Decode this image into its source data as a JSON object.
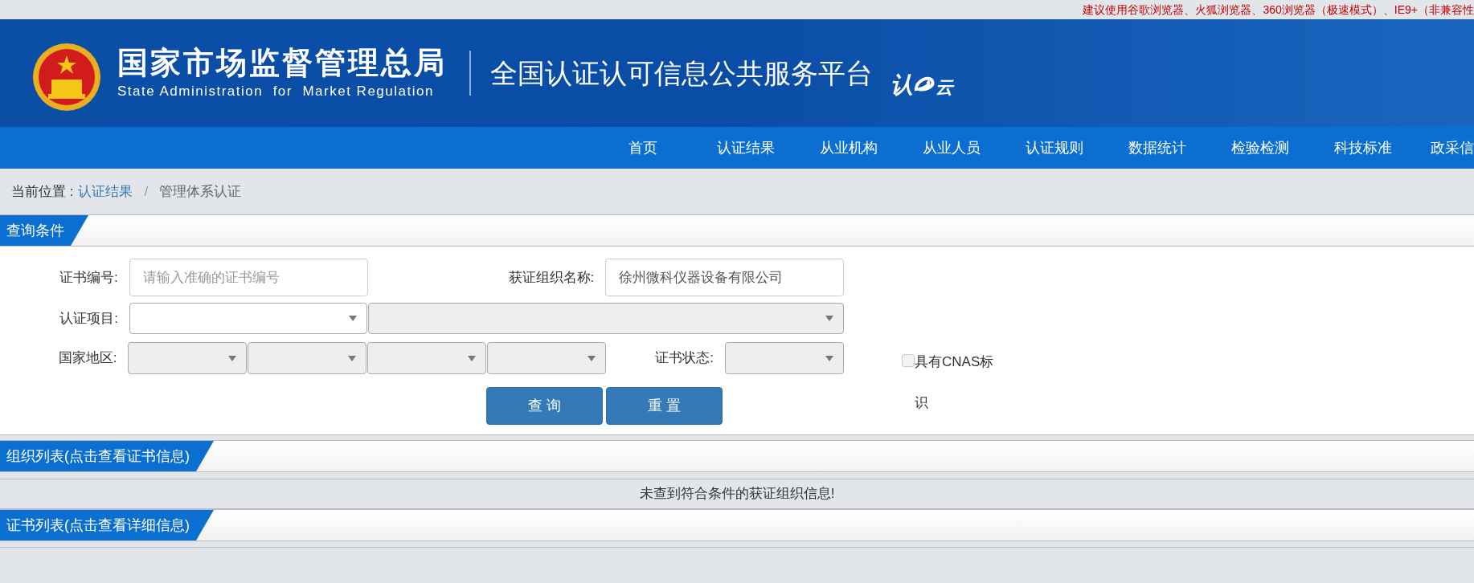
{
  "notice": "建议使用谷歌浏览器、火狐浏览器、360浏览器（极速模式）、IE9+（非兼容性",
  "header": {
    "org_name": "国家市场监督管理总局",
    "org_name_en": "State Administration  for  Market Regulation",
    "platform": "全国认证认可信息公共服务平台",
    "logo_text": [
      "认",
      "云"
    ]
  },
  "nav": [
    "首页",
    "认证结果",
    "从业机构",
    "从业人员",
    "认证规则",
    "数据统计",
    "检验检测",
    "科技标准",
    "政采信"
  ],
  "breadcrumb": {
    "prefix": "当前位置 :",
    "separator": "/",
    "items": [
      {
        "label": "认证结果",
        "kind": "link"
      },
      {
        "label": "管理体系认证",
        "kind": "current"
      }
    ]
  },
  "query_panel": {
    "title": "查询条件",
    "cert_no": {
      "label": "证书编号:",
      "placeholder": "请输入准确的证书编号"
    },
    "org_name": {
      "label": "获证组织名称:",
      "value": "徐州微科仪器设备有限公司"
    },
    "project": {
      "label": "认证项目:",
      "selects": [
        {
          "disabled": false
        },
        {
          "disabled": true
        }
      ]
    },
    "region": {
      "label": "国家地区:",
      "selects": [
        {
          "disabled": true
        },
        {
          "disabled": true
        },
        {
          "disabled": true
        },
        {
          "disabled": true
        }
      ]
    },
    "status": {
      "label": "证书状态:",
      "disabled": true
    },
    "cnas": {
      "label": "具有CNAS标识",
      "checked": false
    },
    "buttons": [
      "查 询",
      "重 置"
    ]
  },
  "org_list": {
    "title": "组织列表(点击查看证书信息)",
    "empty_message": "未查到符合条件的获证组织信息!"
  },
  "cert_list": {
    "title": "证书列表(点击查看详细信息)"
  }
}
